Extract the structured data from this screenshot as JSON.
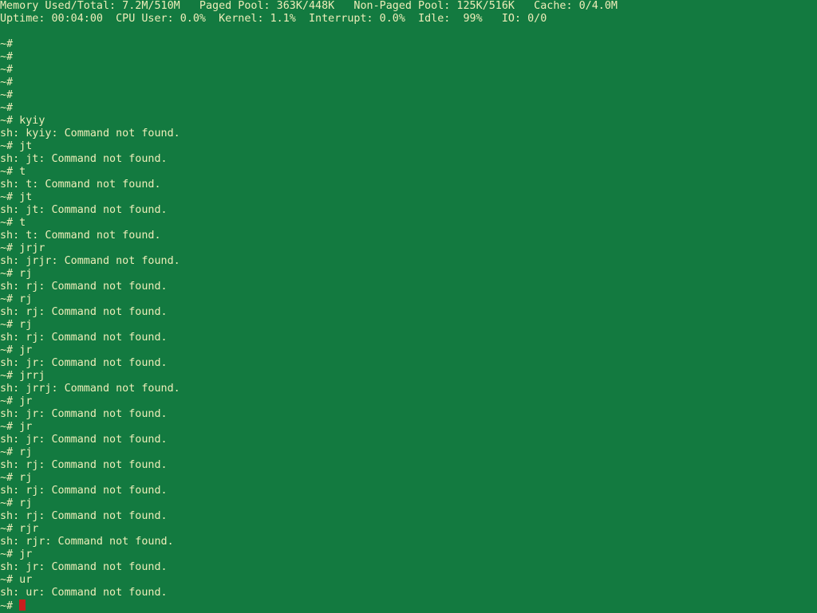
{
  "colors": {
    "background": "#137a40",
    "foreground": "#ededb8",
    "cursor": "#c81e1e"
  },
  "status": {
    "line1": [
      "Memory Used/Total: 7.2M/510M",
      "Paged Pool: 363K/448K",
      "Non-Paged Pool: 125K/516K",
      "Cache: 0/4.0M"
    ],
    "line2": [
      "Uptime: 00:04:00",
      "CPU User: 0.0%",
      "Kernel: 1.1%",
      "Interrupt: 0.0%",
      "Idle:  99%",
      "IO: 0/0"
    ]
  },
  "terminal": {
    "lines": [
      "~#",
      "~#",
      "~#",
      "~#",
      "~#",
      "~#",
      "~# kyiy",
      "sh: kyiy: Command not found.",
      "~# jt",
      "sh: jt: Command not found.",
      "~# t",
      "sh: t: Command not found.",
      "~# jt",
      "sh: jt: Command not found.",
      "~# t",
      "sh: t: Command not found.",
      "~# jrjr",
      "sh: jrjr: Command not found.",
      "~# rj",
      "sh: rj: Command not found.",
      "~# rj",
      "sh: rj: Command not found.",
      "~# rj",
      "sh: rj: Command not found.",
      "~# jr",
      "sh: jr: Command not found.",
      "~# jrrj",
      "sh: jrrj: Command not found.",
      "~# jr",
      "sh: jr: Command not found.",
      "~# jr",
      "sh: jr: Command not found.",
      "~# rj",
      "sh: rj: Command not found.",
      "~# rj",
      "sh: rj: Command not found.",
      "~# rj",
      "sh: rj: Command not found.",
      "~# rjr",
      "sh: rjr: Command not found.",
      "~# jr",
      "sh: jr: Command not found.",
      "~# ur",
      "sh: ur: Command not found."
    ],
    "prompt": "~#"
  }
}
